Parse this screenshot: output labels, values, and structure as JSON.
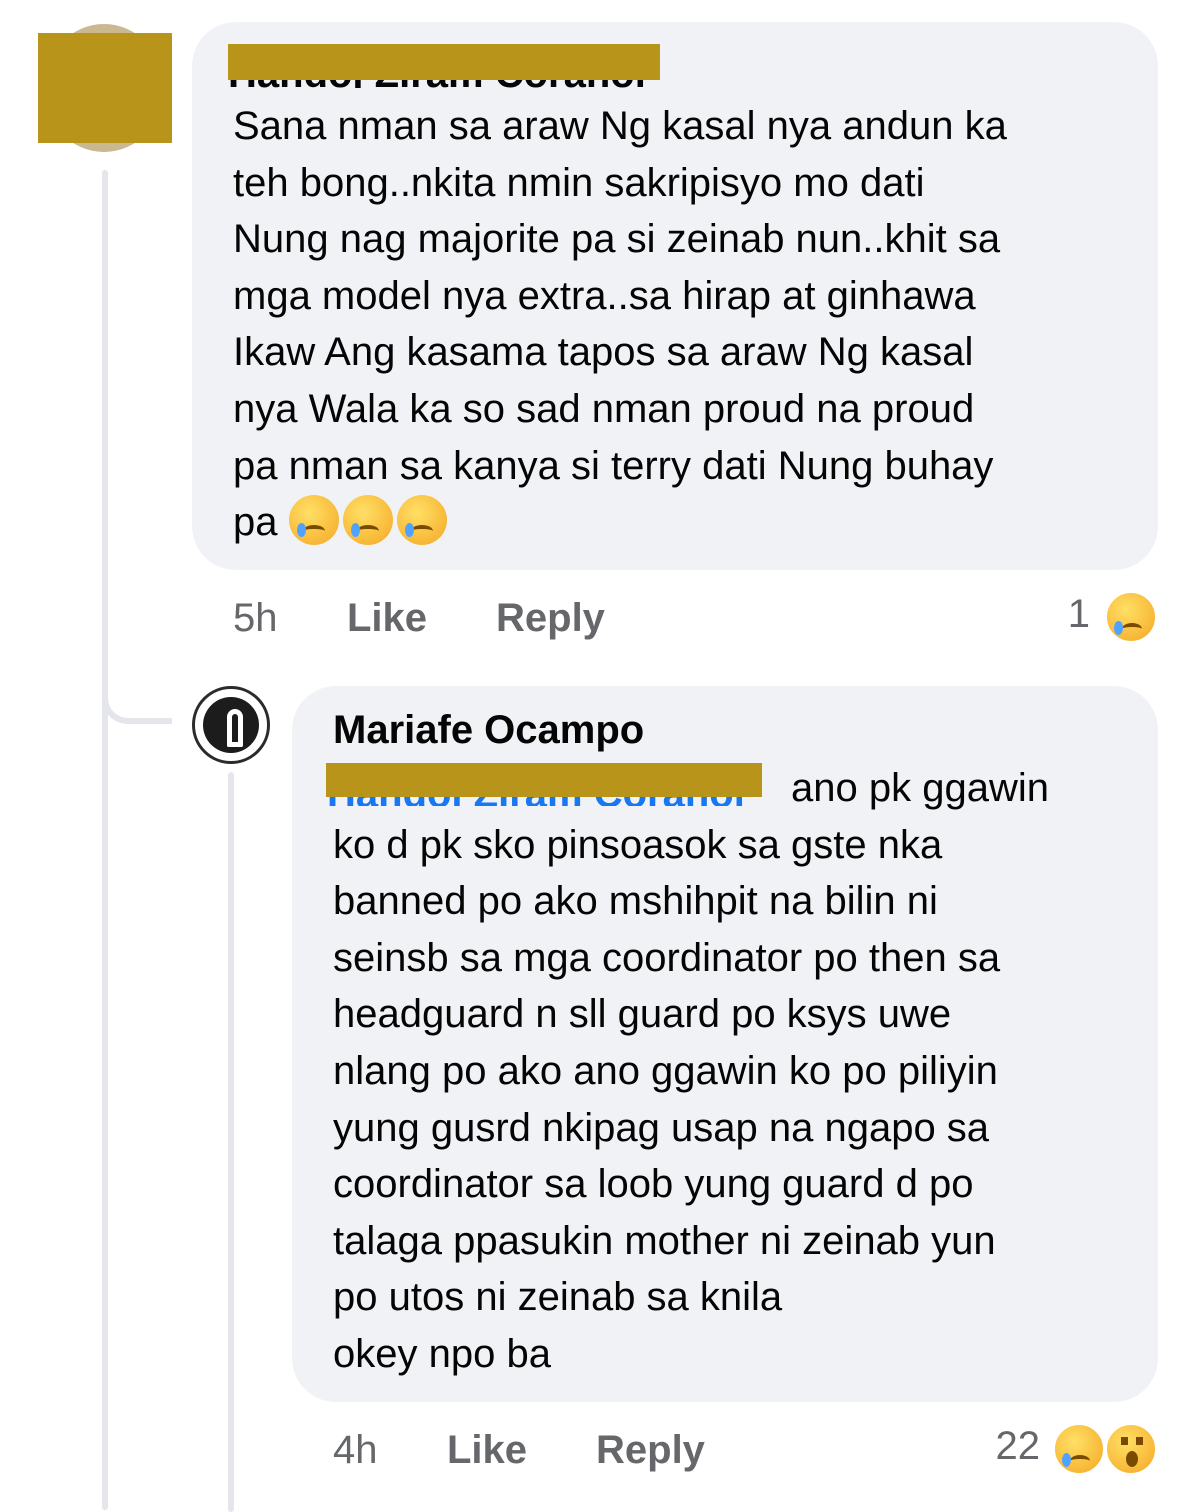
{
  "comment_1": {
    "author_hidden": "Handoj Ziram Coranoi",
    "text": "Sana nman sa araw Ng kasal nya andun ka\nteh bong..nkita nmin sakripisyo mo dati\nNung nag majorite pa si zeinab nun..khit sa\nmga model nya extra..sa hirap at  ginhawa\nIkaw Ang kasama tapos sa araw Ng kasal\nnya Wala ka so sad nman proud na proud\npa nman sa kanya si terry dati Nung buhay\npa",
    "time": "5h",
    "like_label": "Like",
    "reply_label": "Reply",
    "reaction_count": "1",
    "reactions": [
      "sad"
    ]
  },
  "comment_2": {
    "author": "Mariafe Ocampo",
    "mention_hidden": "Handoj Ziram Coranoi",
    "text": "ano pk ggawin\nko  d pk sko pinsoasok sa gste nka\nbanned po  ako  mshihpit na bilin ni\nseinsb sa mga coordinator po then sa\nheadguard n sll guard po  ksys uwe\nnlang po ako  ano ggawin ko po piliyin\nyung gusrd nkipag usap na ngapo sa\ncoordinator  sa loob yung guard d po\ntalaga ppasukin mother ni zeinab yun\npo utos ni zeinab sa knila\nokey npo ba",
    "time": "4h",
    "like_label": "Like",
    "reply_label": "Reply",
    "reaction_count": "22",
    "reactions": [
      "sad",
      "wow"
    ]
  },
  "colors": {
    "bubble": "#f0f2f5",
    "redaction": "#b8941a",
    "meta_text": "#65676b",
    "mention": "#1877f2"
  }
}
